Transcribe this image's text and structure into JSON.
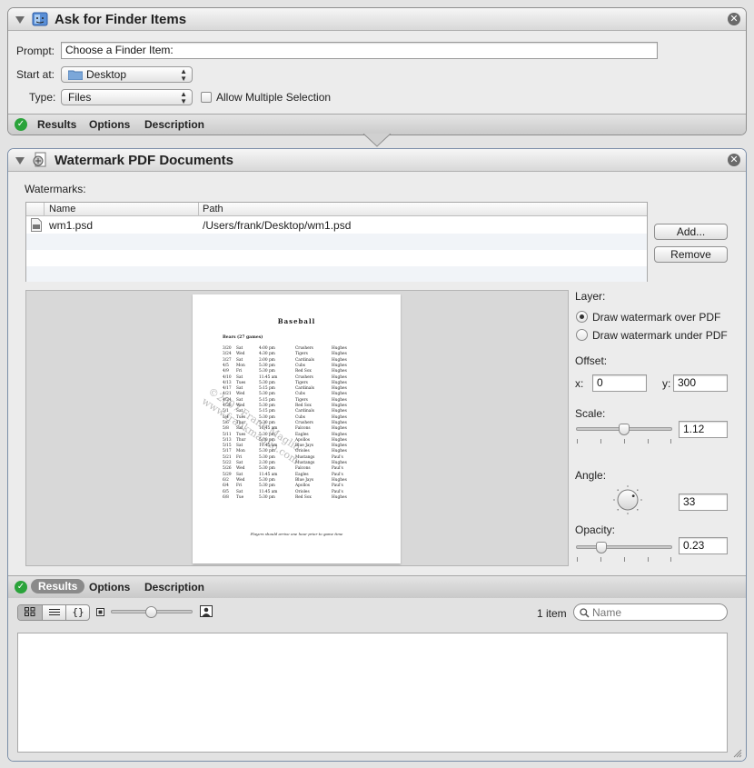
{
  "ask_panel": {
    "title": "Ask for Finder Items",
    "prompt_label": "Prompt:",
    "prompt_value": "Choose a Finder Item:",
    "start_label": "Start at:",
    "start_value": "Desktop",
    "type_label": "Type:",
    "type_value": "Files",
    "allow_multiple_label": "Allow Multiple Selection",
    "allow_multiple_checked": false,
    "footer_tabs": [
      "Results",
      "Options",
      "Description"
    ]
  },
  "watermark_panel": {
    "title": "Watermark PDF Documents",
    "watermarks_label": "Watermarks:",
    "table": {
      "columns": [
        "Name",
        "Path"
      ],
      "rows": [
        {
          "name": "wm1.psd",
          "path": "/Users/frank/Desktop/wm1.psd"
        }
      ]
    },
    "add_button": "Add...",
    "remove_button": "Remove",
    "layer_label": "Layer:",
    "layer_options": [
      "Draw watermark over PDF",
      "Draw watermark under PDF"
    ],
    "layer_selected": 0,
    "offset_label": "Offset:",
    "offset_x_label": "x:",
    "offset_x": "0",
    "offset_y_label": "y:",
    "offset_y": "300",
    "scale_label": "Scale:",
    "scale_value": "1.12",
    "scale_fraction": 0.5,
    "angle_label": "Angle:",
    "angle_value": "33",
    "opacity_label": "Opacity:",
    "opacity_value": "0.23",
    "opacity_fraction": 0.23,
    "preview": {
      "heading": "Baseball",
      "subheading": "Bears (27 games)",
      "watermark_lines": [
        "©2007 Frank Maglio",
        "www.frankmaglio.com"
      ],
      "footer_note": "Players should arrive one hour prior to game time",
      "games": [
        [
          "3/20",
          "Sat",
          "4:00 pm",
          "Crushers",
          "Hughes"
        ],
        [
          "3/24",
          "Wed",
          "4:30 pm",
          "Tigers",
          "Hughes"
        ],
        [
          "3/27",
          "Sat",
          "2:00 pm",
          "Cardinals",
          "Hughes"
        ],
        [
          "4/5",
          "Mon",
          "5:30 pm",
          "Cubs",
          "Hughes"
        ],
        [
          "4/9",
          "Fri",
          "5:30 pm",
          "Red Sox",
          "Hughes"
        ],
        [
          "4/10",
          "Sat",
          "11:45 am",
          "Crushers",
          "Hughes"
        ],
        [
          "4/13",
          "Tues",
          "5:30 pm",
          "Tigers",
          "Hughes"
        ],
        [
          "4/17",
          "Sat",
          "5:15 pm",
          "Cardinals",
          "Hughes"
        ],
        [
          "4/21",
          "Wed",
          "5:30 pm",
          "Cubs",
          "Hughes"
        ],
        [
          "4/24",
          "Sat",
          "5:15 pm",
          "Tigers",
          "Hughes"
        ],
        [
          "4/28",
          "Wed",
          "5:30 pm",
          "Red Sox",
          "Hughes"
        ],
        [
          "5/1",
          "Sat",
          "5:15 pm",
          "Cardinals",
          "Hughes"
        ],
        [
          "5/4",
          "Tues",
          "5:30 pm",
          "Cubs",
          "Hughes"
        ],
        [
          "5/6",
          "Thur",
          "5:30 pm",
          "Crushers",
          "Hughes"
        ],
        [
          "5/8",
          "Sat",
          "11:45 am",
          "Falcons",
          "Hughes"
        ],
        [
          "5/11",
          "Tues",
          "5:30 pm",
          "Eagles",
          "Hughes"
        ],
        [
          "5/13",
          "Thur",
          "5:30 pm",
          "Apollos",
          "Hughes"
        ],
        [
          "5/15",
          "Sat",
          "11:45 am",
          "Blue Jays",
          "Hughes"
        ],
        [
          "5/17",
          "Mon",
          "5:30 pm",
          "Orioles",
          "Hughes"
        ],
        [
          "5/21",
          "Fri",
          "5:30 pm",
          "Mustangs",
          "Paul's"
        ],
        [
          "5/22",
          "Sat",
          "2:30 pm",
          "Mustangs",
          "Hughes"
        ],
        [
          "5/26",
          "Wed",
          "5:30 pm",
          "Falcons",
          "Paul's"
        ],
        [
          "5/29",
          "Sat",
          "11:45 am",
          "Eagles",
          "Paul's"
        ],
        [
          "6/2",
          "Wed",
          "5:30 pm",
          "Blue Jays",
          "Hughes"
        ],
        [
          "6/4",
          "Fri",
          "5:30 pm",
          "Apollos",
          "Paul's"
        ],
        [
          "6/5",
          "Sat",
          "11:45 am",
          "Orioles",
          "Paul's"
        ],
        [
          "6/8",
          "Tue",
          "5:30 pm",
          "Red Sox",
          "Hughes"
        ]
      ]
    },
    "footer_tabs": [
      "Results",
      "Options",
      "Description"
    ],
    "results_selected_tab": 0,
    "item_count": "1 item",
    "search_placeholder": "Name"
  }
}
